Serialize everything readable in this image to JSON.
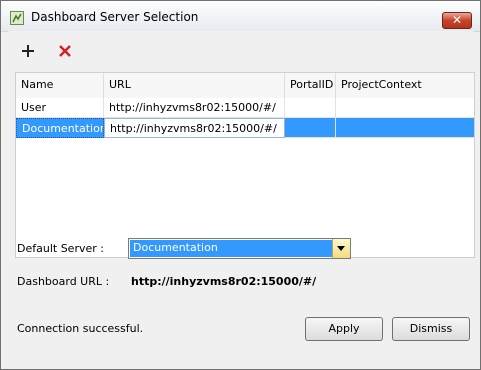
{
  "window": {
    "title": "Dashboard Server Selection",
    "close_glyph": "✕"
  },
  "toolbar": {
    "add_icon": "plus-icon",
    "remove_icon": "red-x-icon"
  },
  "table": {
    "columns": [
      "Name",
      "URL",
      "PortalID",
      "ProjectContext"
    ],
    "rows": [
      {
        "name": "User",
        "url": "http://inhyzvms8r02:15000/#/",
        "portal_id": "",
        "project_context": ""
      },
      {
        "name": "Documentation",
        "url": "http://inhyzvms8r02:15000/#/",
        "portal_id": "",
        "project_context": ""
      }
    ],
    "selected_row": 1
  },
  "form": {
    "default_server_label": "Default Server :",
    "default_server_value": "Documentation",
    "dashboard_url_label": "Dashboard URL :",
    "dashboard_url_value": "http://inhyzvms8r02:15000/#/"
  },
  "status": {
    "message": "Connection successful."
  },
  "buttons": {
    "apply": "Apply",
    "dismiss": "Dismiss"
  },
  "colors": {
    "selection": "#3399ff",
    "remove_icon": "#d2202a",
    "dropdown_arrow_bg": "#f3dc7e"
  }
}
